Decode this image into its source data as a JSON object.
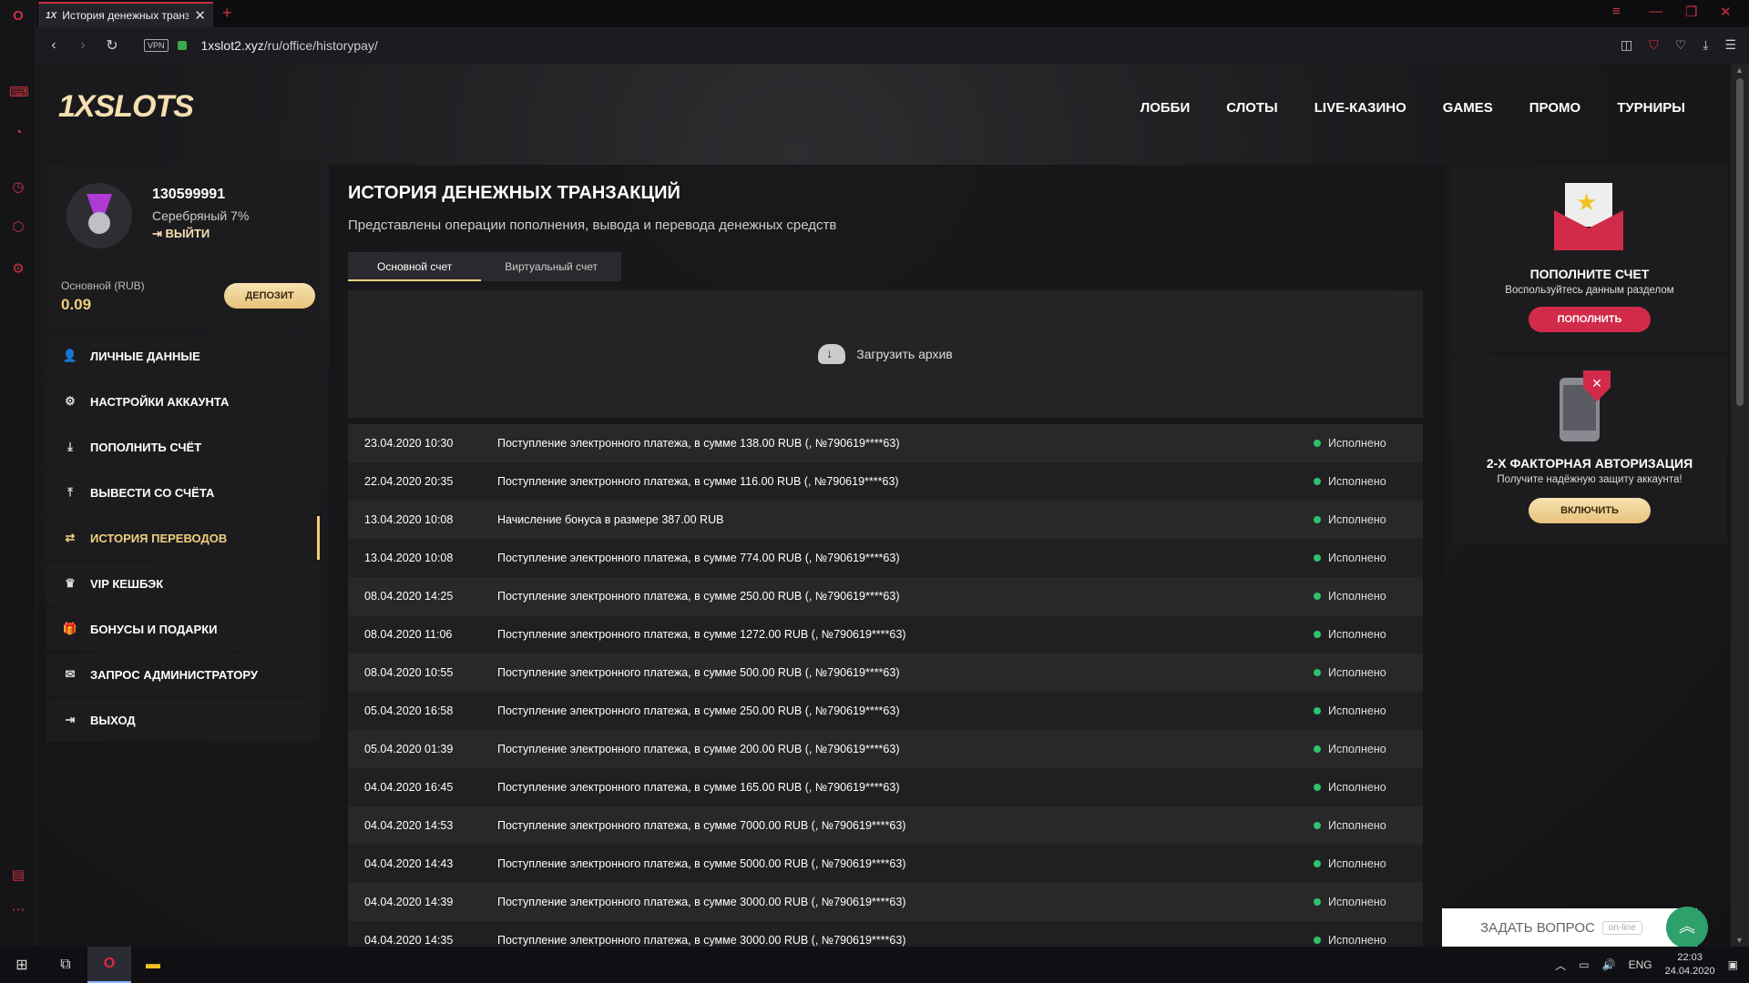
{
  "browser": {
    "tab_title": "История денежных транзакций",
    "tab_favicon": "1X",
    "url_host": "1xslot2.xyz",
    "url_path": "/ru/office/historypay/",
    "vpn_label": "VPN"
  },
  "site": {
    "logo": "1XSLOTS",
    "nav": [
      "ЛОББИ",
      "СЛОТЫ",
      "LIVE-КАЗИНО",
      "GAMES",
      "ПРОМО",
      "ТУРНИРЫ"
    ]
  },
  "profile": {
    "user_id": "130599991",
    "rank": "Серебряный 7%",
    "logout": "ВЫЙТИ",
    "balance_label": "Основной (RUB)",
    "balance": "0.09",
    "deposit_button": "ДЕПОЗИТ"
  },
  "menu": [
    {
      "label": "ЛИЧНЫЕ ДАННЫЕ",
      "icon": "user-icon"
    },
    {
      "label": "НАСТРОЙКИ АККАУНТА",
      "icon": "settings-icon"
    },
    {
      "label": "ПОПОЛНИТЬ СЧЁТ",
      "icon": "download-icon"
    },
    {
      "label": "ВЫВЕСТИ СО СЧЁТА",
      "icon": "upload-icon"
    },
    {
      "label": "ИСТОРИЯ ПЕРЕВОДОВ",
      "icon": "transfer-icon",
      "active": true
    },
    {
      "label": "VIP КЕШБЭК",
      "icon": "crown-icon"
    },
    {
      "label": "БОНУСЫ И ПОДАРКИ",
      "icon": "gift-icon"
    },
    {
      "label": "ЗАПРОС АДМИНИСТРАТОРУ",
      "icon": "mail-icon"
    },
    {
      "label": "ВЫХОД",
      "icon": "logout-icon"
    }
  ],
  "main": {
    "title": "ИСТОРИЯ ДЕНЕЖНЫХ ТРАНЗАКЦИЙ",
    "subtitle": "Представлены операции пополнения, вывода и перевода денежных средств",
    "tabs": [
      "Основной счет",
      "Виртуальный счет"
    ],
    "archive": "Загрузить архив",
    "transactions": [
      {
        "date": "23.04.2020 10:30",
        "desc": "Поступление электронного платежа, в сумме 138.00 RUB (, №790619****63)",
        "status": "Исполнено"
      },
      {
        "date": "22.04.2020 20:35",
        "desc": "Поступление электронного платежа, в сумме 116.00 RUB (, №790619****63)",
        "status": "Исполнено"
      },
      {
        "date": "13.04.2020 10:08",
        "desc": "Начисление бонуса в размере 387.00 RUB",
        "status": "Исполнено"
      },
      {
        "date": "13.04.2020 10:08",
        "desc": "Поступление электронного платежа, в сумме 774.00 RUB (, №790619****63)",
        "status": "Исполнено"
      },
      {
        "date": "08.04.2020 14:25",
        "desc": "Поступление электронного платежа, в сумме 250.00 RUB (, №790619****63)",
        "status": "Исполнено"
      },
      {
        "date": "08.04.2020 11:06",
        "desc": "Поступление электронного платежа, в сумме 1272.00 RUB (, №790619****63)",
        "status": "Исполнено"
      },
      {
        "date": "08.04.2020 10:55",
        "desc": "Поступление электронного платежа, в сумме 500.00 RUB (, №790619****63)",
        "status": "Исполнено"
      },
      {
        "date": "05.04.2020 16:58",
        "desc": "Поступление электронного платежа, в сумме 250.00 RUB (, №790619****63)",
        "status": "Исполнено"
      },
      {
        "date": "05.04.2020 01:39",
        "desc": "Поступление электронного платежа, в сумме 200.00 RUB (, №790619****63)",
        "status": "Исполнено"
      },
      {
        "date": "04.04.2020 16:45",
        "desc": "Поступление электронного платежа, в сумме 165.00 RUB (, №790619****63)",
        "status": "Исполнено"
      },
      {
        "date": "04.04.2020 14:53",
        "desc": "Поступление электронного платежа, в сумме 7000.00 RUB (, №790619****63)",
        "status": "Исполнено"
      },
      {
        "date": "04.04.2020 14:43",
        "desc": "Поступление электронного платежа, в сумме 5000.00 RUB (, №790619****63)",
        "status": "Исполнено"
      },
      {
        "date": "04.04.2020 14:39",
        "desc": "Поступление электронного платежа, в сумме 3000.00 RUB (, №790619****63)",
        "status": "Исполнено"
      },
      {
        "date": "04.04.2020 14:35",
        "desc": "Поступление электронного платежа, в сумме 3000.00 RUB (, №790619****63)",
        "status": "Исполнено"
      }
    ]
  },
  "promos": {
    "deposit": {
      "title": "ПОПОЛНИТЕ СЧЕТ",
      "text": "Воспользуйтесь данным разделом",
      "button": "ПОПОЛНИТЬ"
    },
    "twofa": {
      "title": "2-Х ФАКТОРНАЯ АВТОРИЗАЦИЯ",
      "text": "Получите надёжную защиту аккаунта!",
      "button": "ВКЛЮЧИТЬ"
    }
  },
  "chat": {
    "label": "ЗАДАТЬ ВОПРОС",
    "status": "on-line"
  },
  "taskbar": {
    "lang": "ENG",
    "time": "22:03",
    "date": "24.04.2020"
  },
  "colors": {
    "accent_gold": "#f0cf7e",
    "accent_red": "#d12b49",
    "status_green": "#2cc36b"
  }
}
